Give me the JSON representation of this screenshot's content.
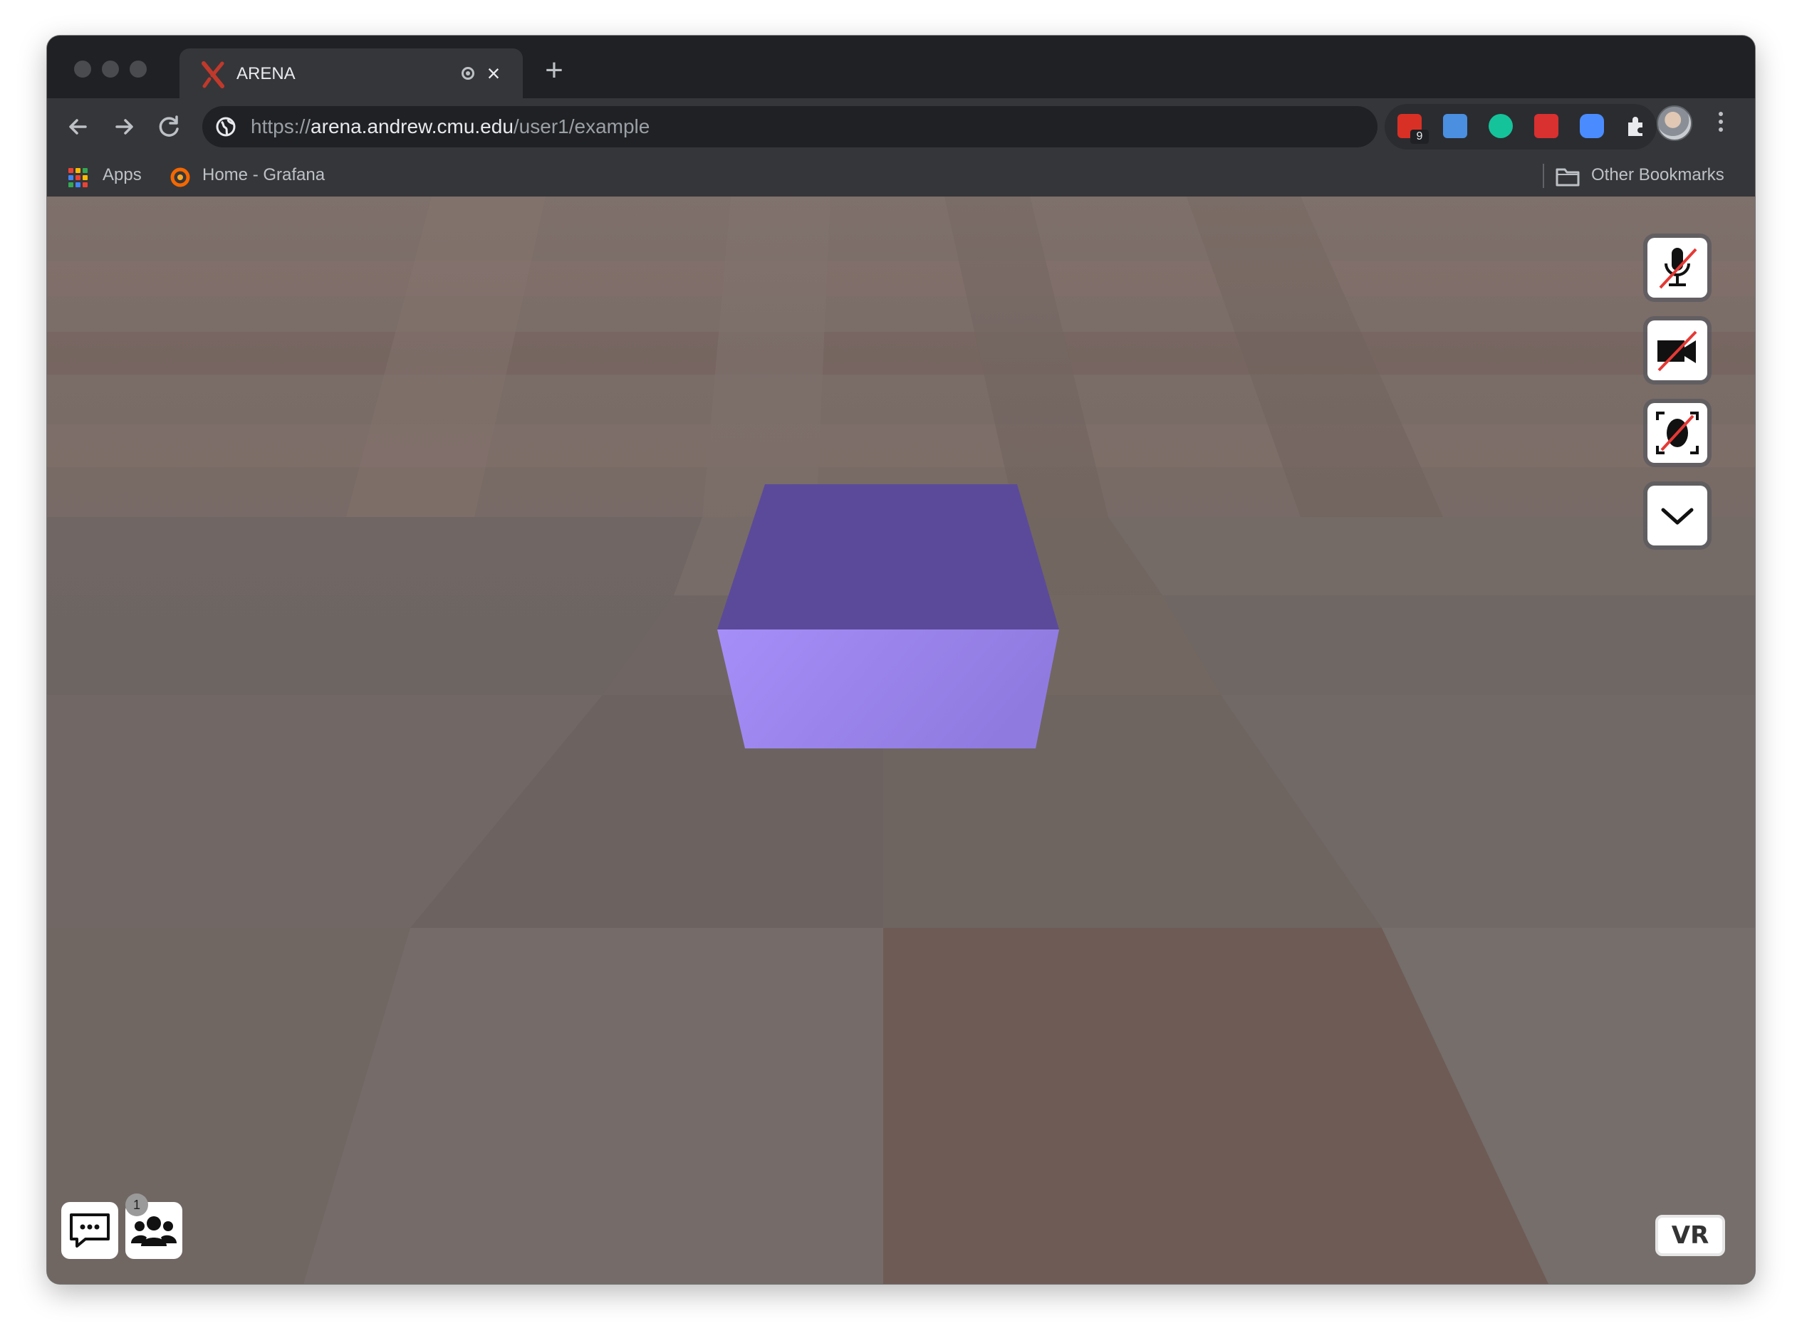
{
  "browser": {
    "tab": {
      "title": "ARENA"
    },
    "address_bar": {
      "scheme": "https://",
      "host": "arena.andrew.cmu.edu",
      "path": "/user1/example"
    },
    "extensions": [
      {
        "name": "calendar-extension-icon",
        "badge": "9",
        "color": "#d93025"
      },
      {
        "name": "window-extension-icon",
        "color": "#4a8fe0"
      },
      {
        "name": "grammarly-extension-icon",
        "color": "#15c39a"
      },
      {
        "name": "mendeley-extension-icon",
        "color": "#d93030"
      },
      {
        "name": "zoom-extension-icon",
        "color": "#4a8cff"
      },
      {
        "name": "puzzle-extensions-icon",
        "color": "#e8eaed"
      }
    ],
    "bookmarks": {
      "apps_label": "Apps",
      "items": [
        {
          "label": "Home - Grafana",
          "icon": "grafana-icon"
        }
      ],
      "other_label": "Other Bookmarks"
    }
  },
  "arena": {
    "controls": [
      {
        "name": "mic-muted-button",
        "icon": "microphone-off-icon"
      },
      {
        "name": "camera-off-button",
        "icon": "video-off-icon"
      },
      {
        "name": "face-tracking-off-button",
        "icon": "face-off-icon"
      },
      {
        "name": "expand-menu-button",
        "icon": "chevron-down-icon"
      }
    ],
    "users_count": "1",
    "vr_label": "VR",
    "box_colors": {
      "top": "#5b4a9a",
      "front": "#a28af5"
    }
  }
}
